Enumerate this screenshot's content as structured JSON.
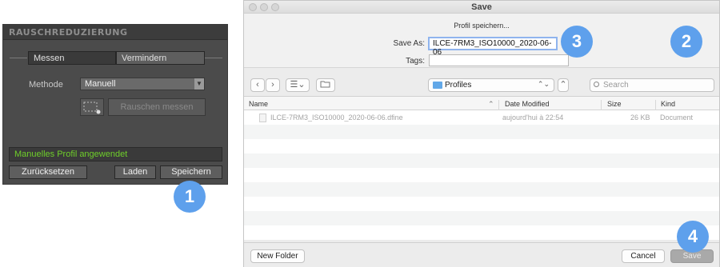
{
  "panel": {
    "title": "RAUSCHREDUZIERUNG",
    "tabs": [
      "Messen",
      "Vermindern"
    ],
    "method_label": "Methode",
    "method_value": "Manuell",
    "measure_noise_button": "Rauschen messen",
    "status": "Manuelles Profil angewendet",
    "reset_button": "Zurücksetzen",
    "load_button": "Laden",
    "save_button": "Speichern"
  },
  "dialog": {
    "window_title": "Save",
    "heading": "Profil speichern...",
    "save_as_label": "Save As:",
    "save_as_value": "ILCE-7RM3_ISO10000_2020-06-06",
    "tags_label": "Tags:",
    "tags_value": "",
    "location": "Profiles",
    "search_placeholder": "Search",
    "columns": {
      "name": "Name",
      "date": "Date Modified",
      "size": "Size",
      "kind": "Kind"
    },
    "files": [
      {
        "name": "ILCE-7RM3_ISO10000_2020-06-06.dfine",
        "date": "aujourd'hui à 22:54",
        "size": "26 KB",
        "kind": "Document"
      }
    ],
    "new_folder_button": "New Folder",
    "cancel_button": "Cancel",
    "save_button": "Save"
  },
  "badges": [
    "1",
    "2",
    "3",
    "4"
  ],
  "colors": {
    "panel_bg": "#4b4b4b",
    "status_text": "#6fcf2a",
    "badge": "#5ea0ec",
    "focus_ring": "#8fb4ee"
  }
}
